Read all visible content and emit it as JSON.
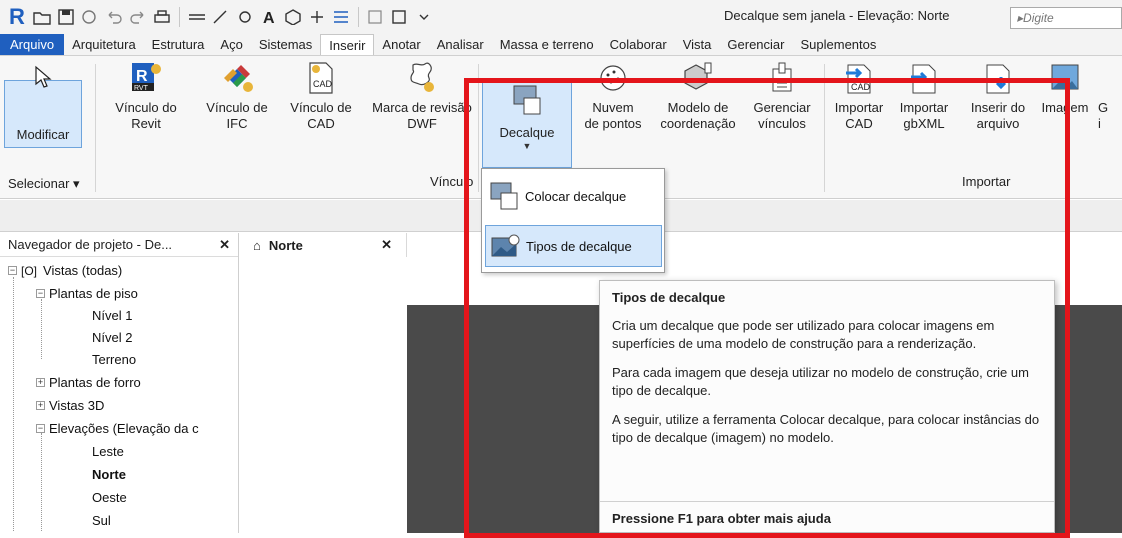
{
  "window": {
    "title": "Decalque sem janela - Elevação: Norte",
    "search_placeholder": "Digite"
  },
  "tabs": [
    "Arquivo",
    "Arquitetura",
    "Estrutura",
    "Aço",
    "Sistemas",
    "Inserir",
    "Anotar",
    "Analisar",
    "Massa e terreno",
    "Colaborar",
    "Vista",
    "Gerenciar",
    "Suplementos"
  ],
  "active_tab": "Inserir",
  "ribbon": {
    "modify": {
      "label": "Modificar",
      "icon": "cursor-icon"
    },
    "select_label": "Selecionar ▾",
    "vinculo_revit": {
      "line1": "Vínculo do",
      "line2": "Revit",
      "icon": "revit-link-icon"
    },
    "vinculo_ifc": {
      "line1": "Vínculo de",
      "line2": "IFC",
      "icon": "ifc-link-icon"
    },
    "vinculo_cad": {
      "line1": "Vínculo de",
      "line2": "CAD",
      "icon": "cad-link-icon"
    },
    "marca_revisao": {
      "line1": "Marca de revisão",
      "line2": "DWF",
      "icon": "dwf-markup-icon"
    },
    "decalque": {
      "line1": "Decalque",
      "icon": "decal-icon"
    },
    "nuvem": {
      "line1": "Nuvem",
      "line2": "de pontos",
      "icon": "point-cloud-icon"
    },
    "modelo_coord": {
      "line1": "Modelo de",
      "line2": "coordenação",
      "icon": "coordination-model-icon"
    },
    "gerenciar": {
      "line1": "Gerenciar",
      "line2": "vínculos",
      "icon": "manage-links-icon"
    },
    "import_cad": {
      "line1": "Importar",
      "line2": "CAD",
      "icon": "import-cad-icon"
    },
    "import_gbxml": {
      "line1": "Importar",
      "line2": "gbXML",
      "icon": "import-gbxml-icon"
    },
    "inserir_arquivo": {
      "line1": "Inserir do",
      "line2": "arquivo",
      "icon": "insert-file-icon"
    },
    "imagem": {
      "line1": "Imagem",
      "icon": "image-icon"
    },
    "trailing": {
      "line1": "G",
      "line2": "i"
    },
    "panel_vinculo": "Vínculo",
    "panel_importar": "Importar"
  },
  "dropdown": {
    "items": [
      {
        "label": "Colocar decalque",
        "icon": "place-decal-icon"
      },
      {
        "label": "Tipos de decalque",
        "icon": "decal-types-icon"
      }
    ]
  },
  "tooltip": {
    "title": "Tipos de decalque",
    "p1": "Cria um decalque que pode ser utilizado para colocar imagens em superfícies de uma modelo de construção para a renderização.",
    "p2": "Para cada imagem que deseja utilizar no modelo de construção, crie um tipo de decalque.",
    "p3": "A seguir, utilize a ferramenta Colocar decalque, para colocar instâncias do tipo de decalque (imagem) no modelo.",
    "footer": "Pressione F1 para obter mais ajuda"
  },
  "browser": {
    "title": "Navegador de projeto - De...",
    "tree": {
      "root": "Vistas (todas)",
      "plantas_piso": "Plantas de piso",
      "nivel1": "Nível 1",
      "nivel2": "Nível 2",
      "terreno": "Terreno",
      "plantas_forro": "Plantas de forro",
      "vistas3d": "Vistas 3D",
      "elevacoes": "Elevações (Elevação da c",
      "leste": "Leste",
      "norte": "Norte",
      "oeste": "Oeste",
      "sul": "Sul"
    }
  },
  "view_tab": {
    "label": "Norte"
  },
  "colors": {
    "accent": "#1f5fbf",
    "highlight_border": "#e4151b",
    "selection_bg": "#d6e8fb"
  }
}
